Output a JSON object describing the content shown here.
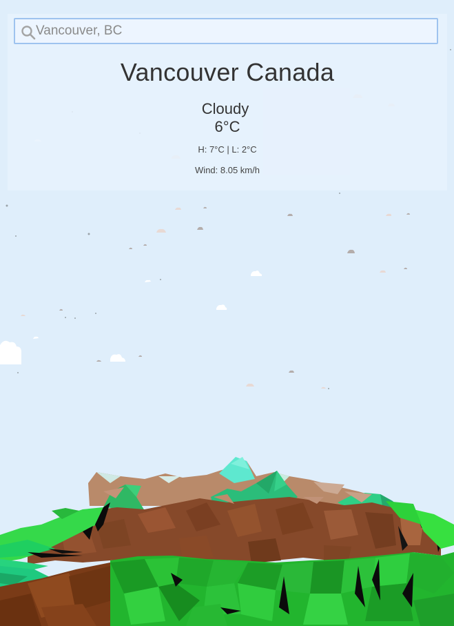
{
  "search": {
    "placeholder": "Vancouver, BC",
    "value": "",
    "icon": "search-icon"
  },
  "weather": {
    "location": "Vancouver Canada",
    "condition": "Cloudy",
    "temperature": "6°C",
    "high_low": "H: 7°C | L: 2°C",
    "wind": "Wind: 8.05 km/h"
  },
  "colors": {
    "sky": "#dfeefb",
    "panel": "#e8f2fd",
    "search_border": "#9ec3ef",
    "grass": "#2ecc40",
    "dirt": "#8b4a22",
    "peak": "#4ee8c0"
  }
}
